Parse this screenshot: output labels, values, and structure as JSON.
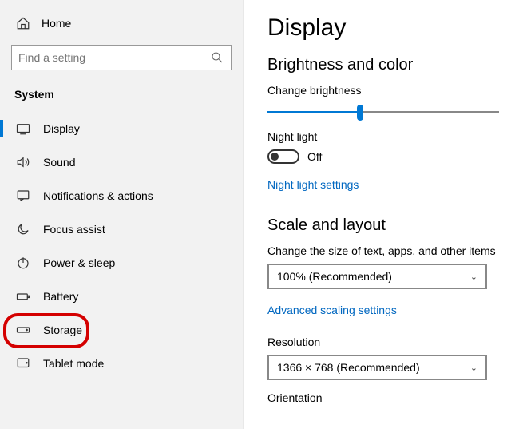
{
  "sidebar": {
    "home_label": "Home",
    "search_placeholder": "Find a setting",
    "section_title": "System",
    "items": [
      {
        "label": "Display"
      },
      {
        "label": "Sound"
      },
      {
        "label": "Notifications & actions"
      },
      {
        "label": "Focus assist"
      },
      {
        "label": "Power & sleep"
      },
      {
        "label": "Battery"
      },
      {
        "label": "Storage"
      },
      {
        "label": "Tablet mode"
      }
    ]
  },
  "main": {
    "page_title": "Display",
    "brightness_section": "Brightness and color",
    "brightness_label": "Change brightness",
    "brightness_percent": 40,
    "night_light_label": "Night light",
    "night_light_state": "Off",
    "night_light_link": "Night light settings",
    "scale_section": "Scale and layout",
    "scale_label": "Change the size of text, apps, and other items",
    "scale_value": "100% (Recommended)",
    "advanced_scaling_link": "Advanced scaling settings",
    "resolution_label": "Resolution",
    "resolution_value": "1366 × 768 (Recommended)",
    "orientation_label": "Orientation"
  }
}
